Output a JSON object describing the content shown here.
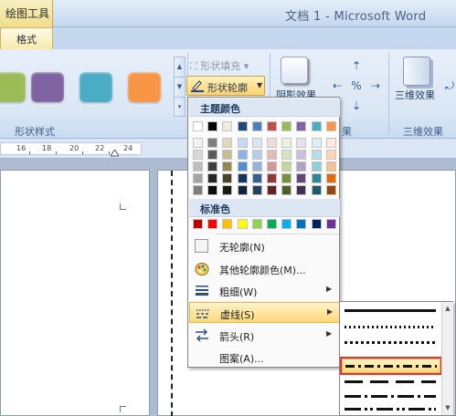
{
  "titlebar": {
    "context_group": "绘图工具",
    "app_title": "文档 1 - Microsoft Word"
  },
  "tabs": {
    "format": "格式"
  },
  "ribbon": {
    "shape_styles_label": "形状样式",
    "style_swatches": [
      "#9bbb59",
      "#8064a2",
      "#4bacc6",
      "#f79646"
    ],
    "shape_fill": "形状填充",
    "shape_outline": "形状轮廓",
    "shadow_effects": "阴影效果",
    "effects_3d": "三维效果",
    "group_fragment": "果",
    "effects_3d_group": "三维效果"
  },
  "ruler": {
    "numbers": [
      "16",
      "18",
      "20",
      "22",
      "24"
    ]
  },
  "outline_menu": {
    "theme_colors_label": "主题颜色",
    "theme_colors_top": [
      "#ffffff",
      "#000000",
      "#eeece1",
      "#1f497d",
      "#4f81bd",
      "#c0504d",
      "#9bbb59",
      "#8064a2",
      "#4bacc6",
      "#f79646"
    ],
    "theme_colors_shades": [
      [
        "#f2f2f2",
        "#7f7f7f",
        "#ddd9c3",
        "#c6d9f0",
        "#dbe5f1",
        "#f2dcdb",
        "#ebf1dd",
        "#e5e0ec",
        "#dbeef3",
        "#fdeada"
      ],
      [
        "#d8d8d8",
        "#595959",
        "#c4bd97",
        "#8db3e2",
        "#b8cce4",
        "#e5b9b7",
        "#d7e3bc",
        "#ccc1d9",
        "#b7dde8",
        "#fbd5b5"
      ],
      [
        "#bfbfbf",
        "#3f3f3f",
        "#938953",
        "#548dd4",
        "#95b3d7",
        "#d99694",
        "#c3d69b",
        "#b2a2c7",
        "#92cddc",
        "#fac08f"
      ],
      [
        "#a5a5a5",
        "#262626",
        "#494429",
        "#17365d",
        "#366092",
        "#953734",
        "#76923c",
        "#5f497a",
        "#31859b",
        "#e36c09"
      ],
      [
        "#7f7f7f",
        "#0c0c0c",
        "#1d1b10",
        "#0f243e",
        "#244061",
        "#632423",
        "#4f6128",
        "#3f3151",
        "#205867",
        "#974806"
      ]
    ],
    "standard_colors_label": "标准色",
    "standard_colors": [
      "#c00000",
      "#ff0000",
      "#ffc000",
      "#ffff00",
      "#92d050",
      "#00b050",
      "#00b0f0",
      "#0070c0",
      "#002060",
      "#7030a0"
    ],
    "no_outline": "无轮廓(N)",
    "more_colors": "其他轮廓颜色(M)...",
    "weight": "粗细(W)",
    "dashes": "虚线(S)",
    "arrows": "箭头(R)",
    "pattern": "图案(A)..."
  }
}
